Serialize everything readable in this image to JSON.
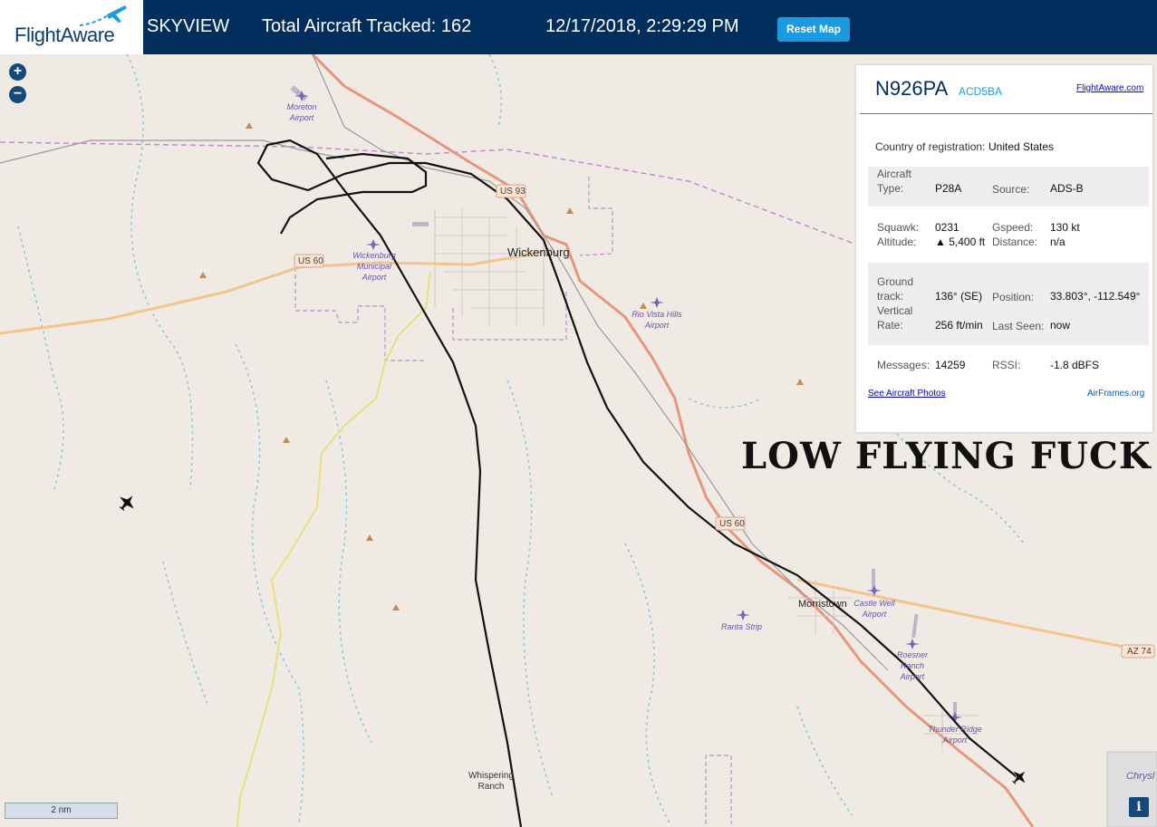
{
  "header": {
    "brand": "FlightAware",
    "mode": "SKYVIEW",
    "total_tracked": "Total Aircraft Tracked: 162",
    "datetime": "12/17/2018, 2:29:29 PM",
    "reset_label": "Reset Map"
  },
  "map_controls": {
    "zoom_in": "+",
    "zoom_out": "−",
    "scale": "2 nm",
    "info": "i"
  },
  "map_labels": {
    "city": "Wickenburg",
    "town": "Morristown",
    "place": "Whispering Ranch",
    "edge_text": "Chrysl",
    "airports": [
      "Moreton Airport",
      "Wickenburg Municipal Airport",
      "Rio Vista Hills Airport",
      "Castle Well Airport",
      "Roesner Ranch Airport",
      "Thunder Ridge Airport",
      "Ranta Strip"
    ],
    "highways": [
      "US 93",
      "US 60",
      "US 60",
      "AZ 74"
    ]
  },
  "aircraft_panel": {
    "registration": "N926PA",
    "hex": "ACD5BA",
    "fa_link": "FlightAware.com",
    "country_label": "Country of registration:",
    "country_value": "United States",
    "type_label": "Aircraft Type:",
    "type_value": "P28A",
    "source_label": "Source:",
    "source_value": "ADS-B",
    "squawk_label": "Squawk:",
    "squawk_value": "0231",
    "gspeed_label": "Gspeed:",
    "gspeed_value": "130 kt",
    "altitude_label": "Altitude:",
    "altitude_value": "▲ 5,400 ft",
    "distance_label": "Distance:",
    "distance_value": "n/a",
    "track_label": "Ground track:",
    "track_value": "136° (SE)",
    "position_label": "Position:",
    "position_value": "33.803°, -112.549°",
    "vrate_label": "Vertical Rate:",
    "vrate_value": "256 ft/min",
    "lastseen_label": "Last Seen:",
    "lastseen_value": "now",
    "messages_label": "Messages:",
    "messages_value": "14259",
    "rssi_label": "RSSI:",
    "rssi_value": "-1.8 dBFS",
    "photos_link": "See Aircraft Photos",
    "airframes_link": "AirFrames.org"
  },
  "caption": "LOW FLYING FUCK"
}
